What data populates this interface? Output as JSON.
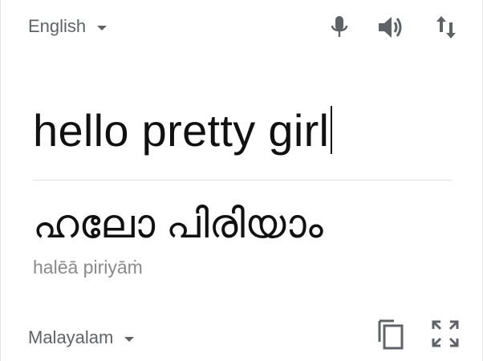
{
  "source_language": {
    "label": "English",
    "icon": "chevron-down-icon"
  },
  "toolbar": {
    "mic_icon": "mic-icon",
    "speaker_icon": "speaker-icon",
    "swap_icon": "swap-languages-icon"
  },
  "input": {
    "text": "hello pretty girl"
  },
  "translation": {
    "text": "ഹലോ പിരിയാം",
    "transliteration": "halēā piriyāṁ"
  },
  "target_language": {
    "label": "Malayalam",
    "icon": "chevron-down-icon"
  },
  "footer_actions": {
    "copy_icon": "copy-icon",
    "fullscreen_icon": "fullscreen-icon"
  },
  "colors": {
    "text_primary": "#111111",
    "text_secondary": "#5f6368",
    "transliteration": "#8a8a8a",
    "icon": "#5f6368",
    "divider": "#e0e0e0"
  }
}
